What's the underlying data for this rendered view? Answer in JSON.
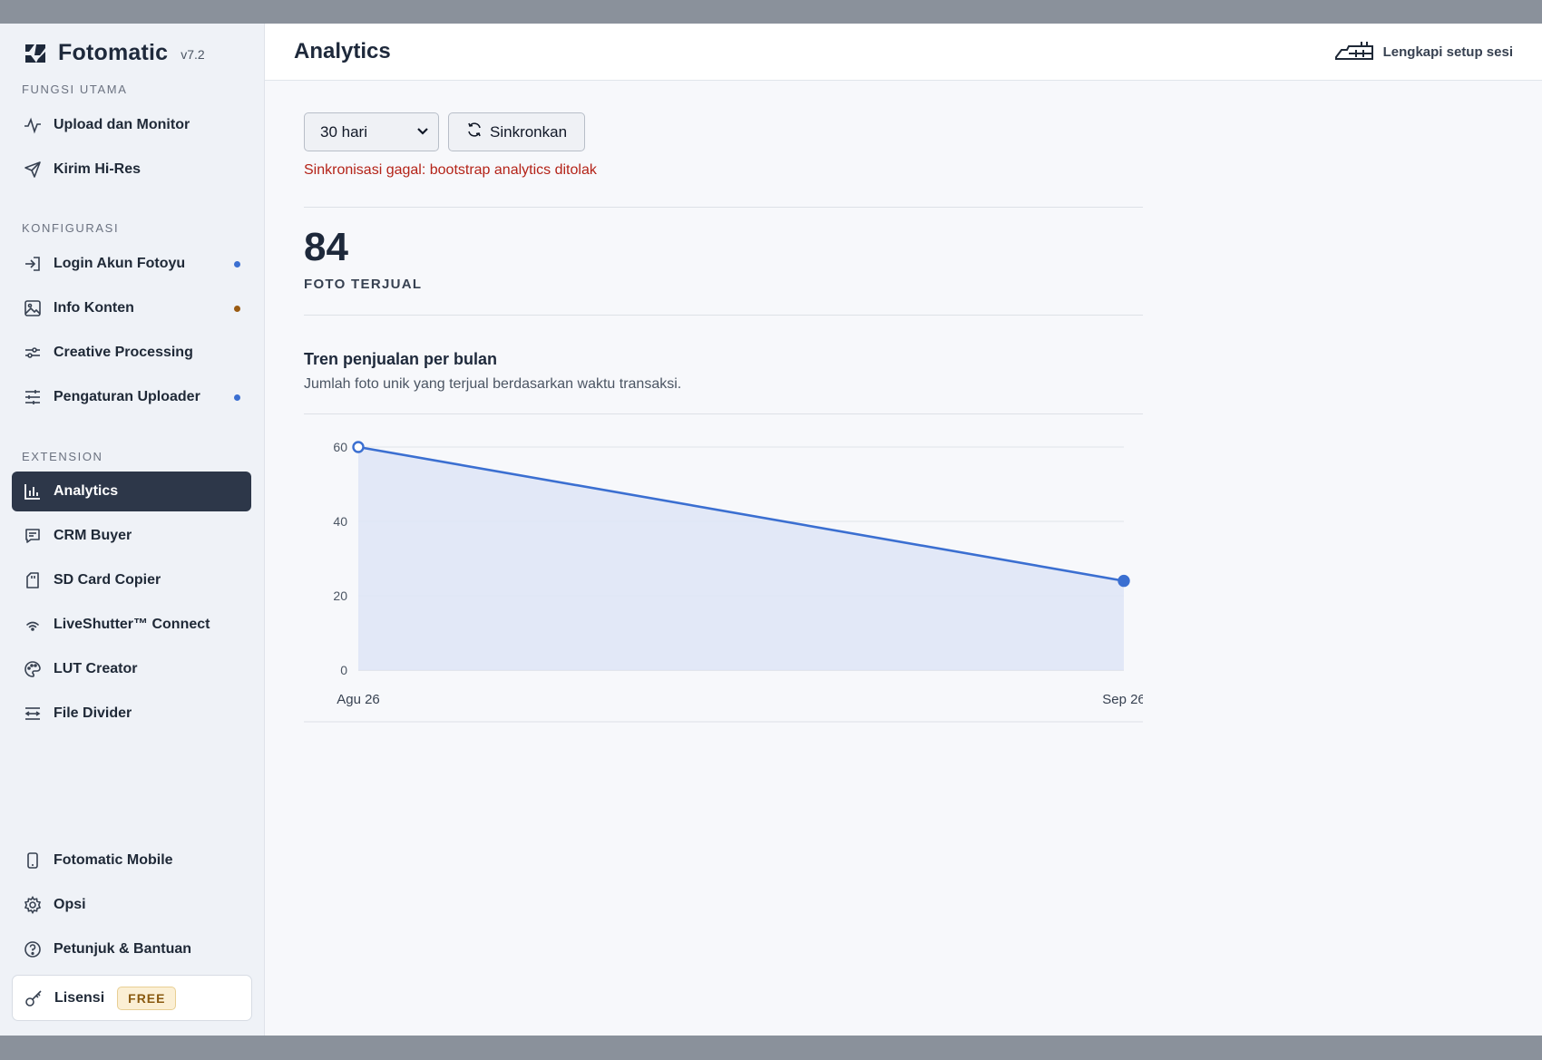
{
  "brand": {
    "name": "Fotomatic",
    "version": "v7.2"
  },
  "sidebar": {
    "sections": [
      {
        "label": "FUNGSI UTAMA"
      },
      {
        "label": "KONFIGURASI"
      },
      {
        "label": "EXTENSION"
      }
    ],
    "items": [
      {
        "label": "Upload dan Monitor",
        "icon": "activity-icon"
      },
      {
        "label": "Kirim Hi-Res",
        "icon": "send-icon"
      },
      {
        "label": "Login Akun Fotoyu",
        "icon": "login-icon",
        "dot": "#3b6fd1"
      },
      {
        "label": "Info Konten",
        "icon": "image-icon",
        "dot": "#9a5b12"
      },
      {
        "label": "Creative Processing",
        "icon": "sliders-icon"
      },
      {
        "label": "Pengaturan Uploader",
        "icon": "settings-sliders-icon",
        "dot": "#3b6fd1"
      },
      {
        "label": "Analytics",
        "icon": "bar-chart-icon",
        "active": true
      },
      {
        "label": "CRM Buyer",
        "icon": "message-icon"
      },
      {
        "label": "SD Card Copier",
        "icon": "sd-card-icon"
      },
      {
        "label": "LiveShutter™ Connect",
        "icon": "wifi-icon"
      },
      {
        "label": "LUT Creator",
        "icon": "palette-icon"
      },
      {
        "label": "File Divider",
        "icon": "divider-icon"
      },
      {
        "label": "Fotomatic Mobile",
        "icon": "phone-icon"
      },
      {
        "label": "Opsi",
        "icon": "gear-icon"
      },
      {
        "label": "Petunjuk & Bantuan",
        "icon": "help-icon"
      }
    ],
    "license": {
      "label": "Lisensi",
      "badge": "FREE",
      "icon": "key-icon"
    }
  },
  "header": {
    "title": "Analytics",
    "setup_link": "Lengkapi setup sesi"
  },
  "controls": {
    "range_select": "30 hari",
    "sync_button": "Sinkronkan",
    "error": "Sinkronisasi gagal: bootstrap analytics ditolak"
  },
  "stat": {
    "value": "84",
    "label": "FOTO TERJUAL"
  },
  "chart_section": {
    "title": "Tren penjualan per bulan",
    "subtitle": "Jumlah foto unik yang terjual berdasarkan waktu transaksi."
  },
  "colors": {
    "accent": "#3b6fd1",
    "sidebar_active": "#2d3749",
    "error": "#b42318"
  },
  "chart_data": {
    "type": "area",
    "categories": [
      "Agu 26",
      "Sep 26"
    ],
    "series": [
      {
        "values": [
          60,
          24
        ]
      }
    ],
    "yticks": [
      0,
      20,
      40,
      60
    ],
    "ylim": [
      0,
      60
    ],
    "grid": true
  }
}
